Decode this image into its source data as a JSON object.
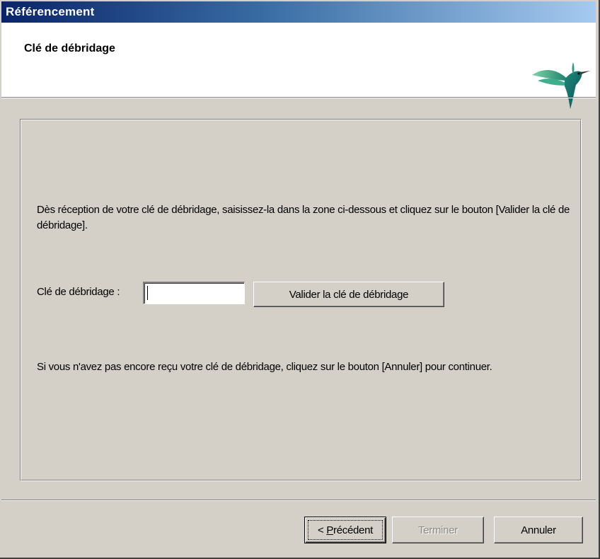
{
  "window": {
    "title": "Référencement"
  },
  "header": {
    "heading": "Clé de débridage",
    "logo_icon": "hummingbird-icon"
  },
  "content": {
    "instruction_text": "Dès réception de votre clé de débridage, saisissez-la dans la zone ci-dessous et cliquez sur le bouton [Valider la clé de débridage].",
    "key_label": "Clé de débridage :",
    "key_value": "",
    "validate_button": "Valider la clé de débridage",
    "cancel_hint_text": "Si vous n'avez pas encore reçu votre clé de débridage, cliquez sur le bouton [Annuler] pour continuer."
  },
  "footer": {
    "previous_prefix": "< ",
    "previous_mnemonic": "P",
    "previous_rest": "récédent",
    "finish_button": "Terminer",
    "finish_enabled": false,
    "cancel_button": "Annuler"
  },
  "colors": {
    "title_bar_start": "#0a246a",
    "title_bar_end": "#a6caf0",
    "dialog_face": "#d4d0c8",
    "disabled_text": "#8c8a84"
  }
}
